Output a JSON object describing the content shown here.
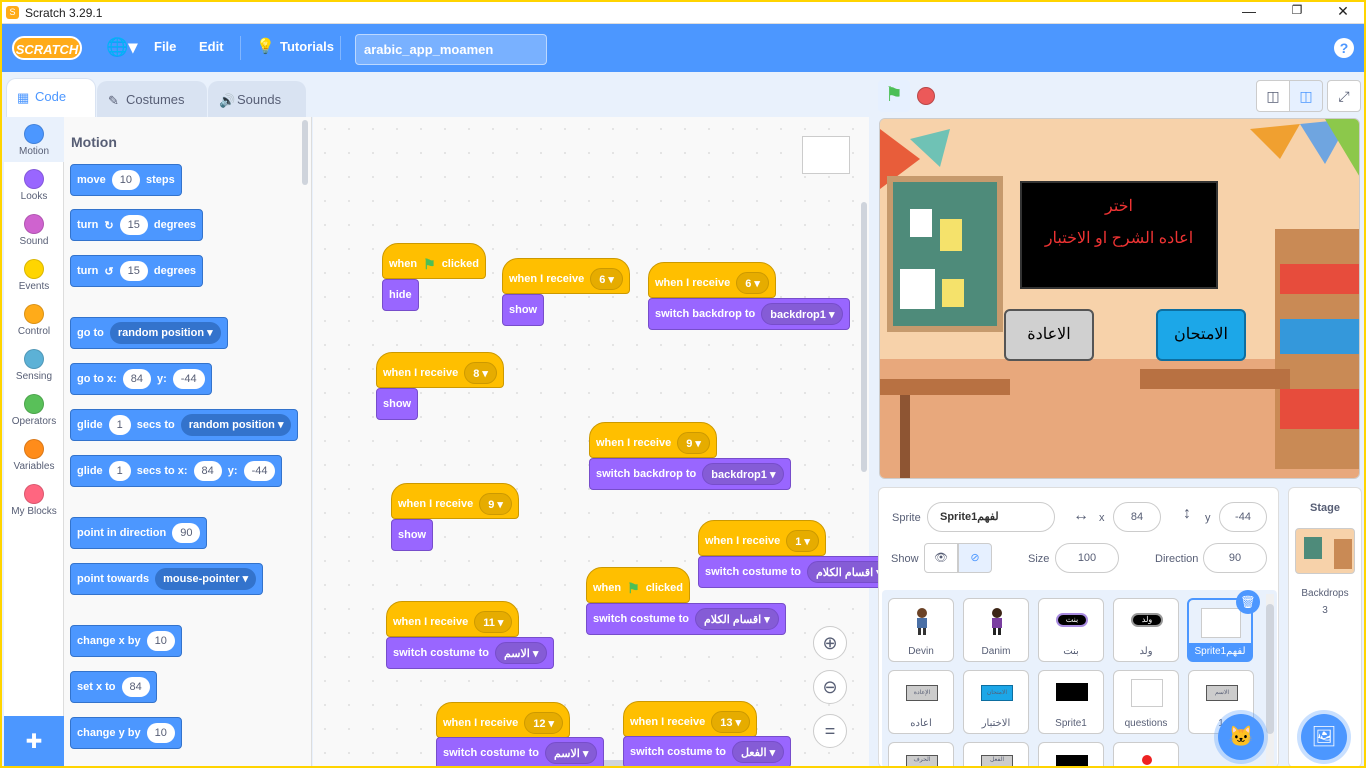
{
  "window": {
    "title": "Scratch 3.29.1",
    "minimize": "—",
    "restore": "❐",
    "close": "✕"
  },
  "menu": {
    "logo": "SCRATCH",
    "file": "File",
    "edit": "Edit",
    "tutorials": "Tutorials",
    "project_title": "arabic_app_moamen",
    "help": "?"
  },
  "tabs": {
    "code": "Code",
    "costumes": "Costumes",
    "sounds": "Sounds"
  },
  "categories": [
    {
      "label": "Motion",
      "color": "#4c97ff"
    },
    {
      "label": "Looks",
      "color": "#9966ff"
    },
    {
      "label": "Sound",
      "color": "#cf63cf"
    },
    {
      "label": "Events",
      "color": "#ffd500"
    },
    {
      "label": "Control",
      "color": "#ffab19"
    },
    {
      "label": "Sensing",
      "color": "#5cb1d6"
    },
    {
      "label": "Operators",
      "color": "#59c059"
    },
    {
      "label": "Variables",
      "color": "#ff8c1a"
    },
    {
      "label": "My Blocks",
      "color": "#ff6680"
    }
  ],
  "palette": {
    "title": "Motion",
    "move": {
      "a": "move",
      "v": "10",
      "b": "steps"
    },
    "turn_right": {
      "a": "turn",
      "v": "15",
      "b": "degrees"
    },
    "turn_left": {
      "a": "turn",
      "v": "15",
      "b": "degrees"
    },
    "goto": {
      "a": "go to",
      "d": "random position"
    },
    "goto_xy": {
      "a": "go to x:",
      "x": "84",
      "b": "y:",
      "y": "-44"
    },
    "glide": {
      "a": "glide",
      "v": "1",
      "b": "secs to",
      "d": "random position"
    },
    "glide_xy": {
      "a": "glide",
      "v": "1",
      "b": "secs to x:",
      "x": "84",
      "c": "y:",
      "y": "-44"
    },
    "point_dir": {
      "a": "point in direction",
      "v": "90"
    },
    "point_towards": {
      "a": "point towards",
      "d": "mouse-pointer"
    },
    "change_x": {
      "a": "change x by",
      "v": "10"
    },
    "set_x": {
      "a": "set x to",
      "v": "84"
    },
    "change_y": {
      "a": "change y by",
      "v": "10"
    }
  },
  "scripts": {
    "when": "when",
    "clicked": "clicked",
    "when_receive": "when I receive",
    "hide": "hide",
    "show": "show",
    "switch_backdrop": "switch backdrop to",
    "switch_costume": "switch costume to",
    "msg6": "6",
    "msg8": "8",
    "msg9": "9",
    "msg1": "1",
    "msg11": "11",
    "msg12": "12",
    "msg13": "13",
    "backdrop1": "backdrop1",
    "cost_divisions": "اقسام الكلام",
    "cost_name": "الاسم",
    "cost_verb": "الفعل"
  },
  "stage": {
    "banner_line1": "اختر",
    "banner_line2": "اعاده الشرح او الاختبار",
    "btn_repeat": "الاعادة",
    "btn_exam": "الامتحان"
  },
  "sprite_info": {
    "sprite_label": "Sprite",
    "sprite_name": "Sprite1لفهم",
    "x_label": "x",
    "x": "84",
    "y_label": "y",
    "y": "-44",
    "show_label": "Show",
    "size_label": "Size",
    "size": "100",
    "direction_label": "Direction",
    "direction": "90"
  },
  "sprites": [
    {
      "name": "Devin"
    },
    {
      "name": "Danim"
    },
    {
      "name": "بنت"
    },
    {
      "name": "ولد"
    },
    {
      "name": "Sprite1لفهم"
    },
    {
      "name": "اعاده"
    },
    {
      "name": "الاختبار"
    },
    {
      "name": "Sprite1"
    },
    {
      "name": "questions"
    },
    {
      "name": "1"
    }
  ],
  "tile_text": {
    "girl": "بنت",
    "boy": "ولد",
    "repeat": "الإعادة",
    "exam": "الامتحان",
    "name": "الاسم",
    "verb": "الفعل",
    "letter": "الحرف"
  },
  "stage_pane": {
    "title": "Stage",
    "backdrops_label": "Backdrops",
    "backdrops_count": "3"
  }
}
